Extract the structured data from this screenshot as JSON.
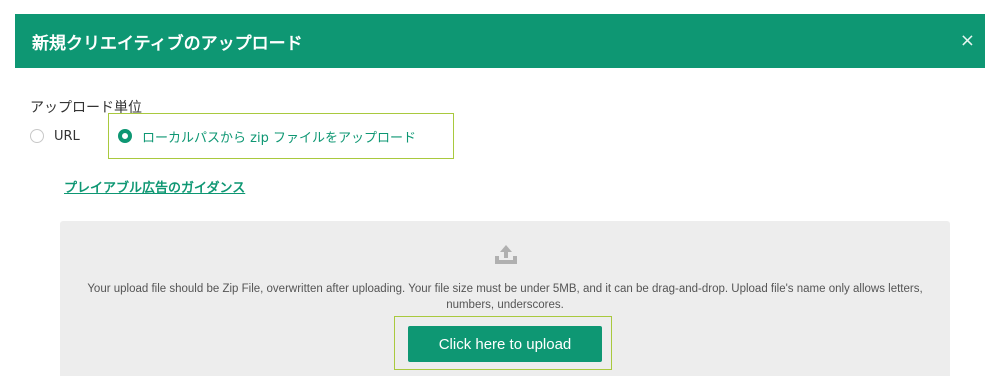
{
  "dialog": {
    "title": "新規クリエイティブのアップロード",
    "close_symbol": "×"
  },
  "upload_unit": {
    "label": "アップロード単位",
    "options": [
      {
        "label": "URL",
        "selected": false
      },
      {
        "label": "ローカルパスから zip ファイルをアップロード",
        "selected": true
      }
    ]
  },
  "guidance_link": "プレイアブル広告のガイダンス",
  "dropzone": {
    "icon": "upload-icon",
    "text": "Your upload file should be Zip File, overwritten after uploading. Your file size must be under 5MB, and it can be drag-and-drop. Upload file's name only allows letters, numbers, underscores.",
    "button_label": "Click here to upload"
  },
  "colors": {
    "accent": "#0e9773",
    "highlight_border": "#a9c93e",
    "dropzone_bg": "#ededed"
  }
}
